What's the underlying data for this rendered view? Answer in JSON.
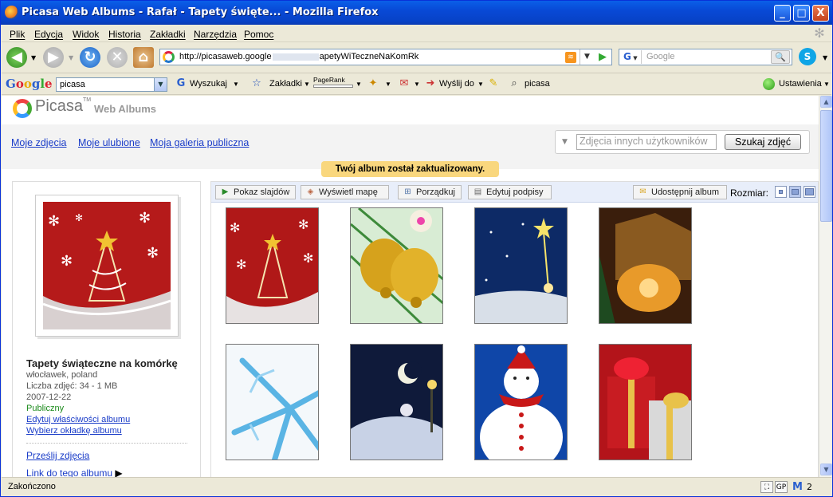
{
  "window": {
    "title": "Picasa Web Albums - Rafał - Tapety święte... - Mozilla Firefox",
    "minimize": "_",
    "maximize": "□",
    "close": "X"
  },
  "menu": [
    "Plik",
    "Edycja",
    "Widok",
    "Historia",
    "Zakładki",
    "Narzędzia",
    "Pomoc"
  ],
  "nav": {
    "url": "http://picasaweb.google",
    "url_tail": "apetyWiTeczneNaKomRk",
    "search_engine": "G",
    "search_placeholder": "Google",
    "search_button_icon": "search-icon",
    "back_icon": "back-arrow-icon",
    "forward_icon": "forward-arrow-icon",
    "reload_icon": "reload-icon",
    "stop_icon": "stop-icon",
    "home_icon": "home-icon"
  },
  "google_toolbar": {
    "logo": "Google",
    "query": "picasa",
    "search": "Wyszukaj",
    "bookmarks": "Zakładki",
    "pagerank": "PageRank",
    "send_to": "Wyślij do",
    "highlight_term": "picasa",
    "settings": "Ustawienia"
  },
  "picasa": {
    "brand": "Picasa",
    "brand_sup": "TM",
    "product": "Web Albums",
    "links": [
      "Moje zdjęcia",
      "Moje ulubione",
      "Moja galeria publiczna"
    ],
    "search_placeholder": "Zdjęcia innych użytkowników",
    "search_button": "Szukaj zdjęć",
    "notice": "Twój album został zaktualizowany.",
    "album": {
      "title": "Tapety świąteczne na komórkę",
      "location": "włocławek, poland",
      "count": "Liczba zdjęć: 34 - 1 MB",
      "date": "2007-12-22",
      "visibility": "Publiczny",
      "edit_props": "Edytuj właściwości albumu",
      "choose_cover": "Wybierz okładkę albumu",
      "upload": "Prześlij zdjęcia",
      "album_link": "Link do tego albumu"
    },
    "actions": {
      "slideshow": "Pokaz slajdów",
      "map": "Wyświetl mapę",
      "organize": "Porządkuj",
      "captions": "Edytuj podpisy",
      "share": "Udostępnij album",
      "size_label": "Rozmiar:"
    },
    "thumbnails": [
      {
        "name": "christmas-tree-red",
        "colors": [
          "#b01818",
          "#e7e2e2"
        ]
      },
      {
        "name": "golden-bells",
        "colors": [
          "#d6a21c",
          "#3d8a3a"
        ]
      },
      {
        "name": "star-night",
        "colors": [
          "#0d2a66",
          "#f6e36a"
        ]
      },
      {
        "name": "nativity-scene",
        "colors": [
          "#3a1e0c",
          "#e89a2a"
        ]
      },
      {
        "name": "blue-snowflake",
        "colors": [
          "#f4f8fb",
          "#5ab4e4"
        ]
      },
      {
        "name": "snowman-moon",
        "colors": [
          "#0f1a3a",
          "#e6e6f0"
        ]
      },
      {
        "name": "snowman-red-hat",
        "colors": [
          "#0f46a8",
          "#ffffff"
        ]
      },
      {
        "name": "red-gifts",
        "colors": [
          "#b3141a",
          "#e8c24a"
        ]
      }
    ]
  },
  "status": {
    "text": "Zakończono",
    "mail_count": "2"
  }
}
